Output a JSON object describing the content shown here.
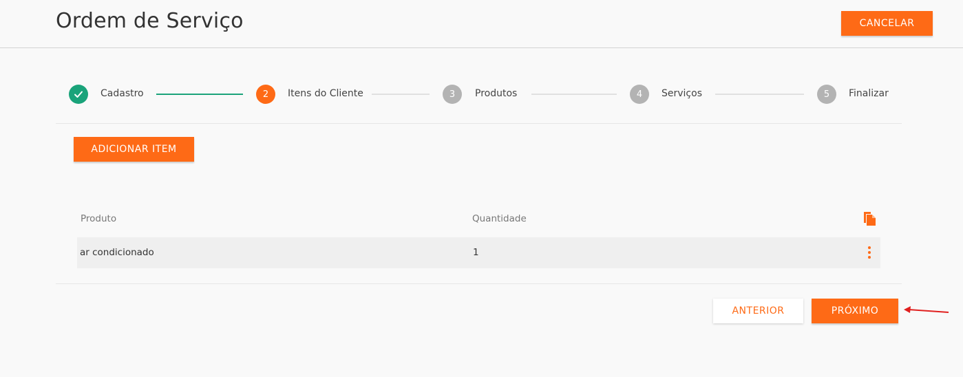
{
  "header": {
    "title": "Ordem de Serviço",
    "cancel_label": "CANCELAR"
  },
  "stepper": {
    "steps": [
      {
        "number": "1",
        "label": "Cadastro",
        "state": "done"
      },
      {
        "number": "2",
        "label": "Itens do Cliente",
        "state": "active"
      },
      {
        "number": "3",
        "label": "Produtos",
        "state": "pending"
      },
      {
        "number": "4",
        "label": "Serviços",
        "state": "pending"
      },
      {
        "number": "5",
        "label": "Finalizar",
        "state": "pending"
      }
    ]
  },
  "actions": {
    "add_item_label": "ADICIONAR ITEM"
  },
  "table": {
    "columns": [
      "Produto",
      "Quantidade"
    ],
    "rows": [
      {
        "produto": "ar condicionado",
        "quantidade": "1"
      }
    ],
    "copy_icon": "copy-icon",
    "row_menu_icon": "more-vert-icon"
  },
  "footer": {
    "previous_label": "ANTERIOR",
    "next_label": "PRÓXIMO"
  },
  "colors": {
    "accent": "#fe6a16",
    "success": "#1aa37a",
    "pending": "#b3b3b3",
    "annotation_arrow": "#e0201f"
  }
}
